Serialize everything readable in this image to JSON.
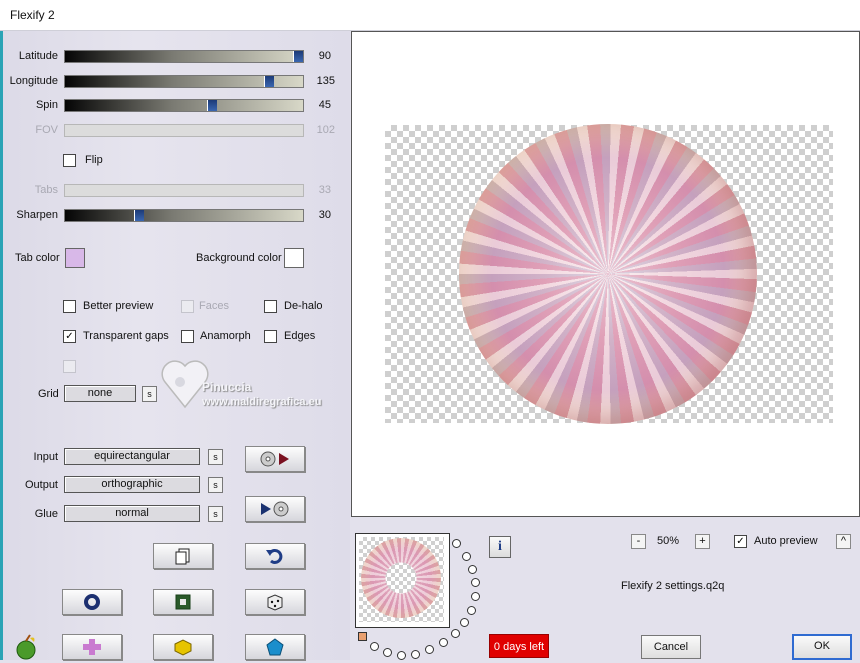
{
  "window": {
    "title": "Flexify 2"
  },
  "sliders": [
    {
      "label": "Latitude",
      "value": "90",
      "fraction": 1.0,
      "enabled": true
    },
    {
      "label": "Longitude",
      "value": "135",
      "fraction": 0.86,
      "enabled": true
    },
    {
      "label": "Spin",
      "value": "45",
      "fraction": 0.61,
      "enabled": true
    },
    {
      "label": "FOV",
      "value": "102",
      "fraction": null,
      "enabled": false
    },
    {
      "label": "Tabs",
      "value": "33",
      "fraction": null,
      "enabled": false
    },
    {
      "label": "Sharpen",
      "value": "30",
      "fraction": 0.3,
      "enabled": true
    }
  ],
  "flip": {
    "label": "Flip",
    "checked": false
  },
  "colors": {
    "tab_label": "Tab color",
    "tab_value": "#d8b8e8",
    "bg_label": "Background color",
    "bg_value": "#ffffff",
    "accent": "#2f6bd1",
    "trial_red": "#e00000"
  },
  "options": {
    "better_preview": {
      "label": "Better preview",
      "checked": false
    },
    "faces": {
      "label": "Faces",
      "checked": false,
      "enabled": false
    },
    "dehalo": {
      "label": "De-halo",
      "checked": false
    },
    "transparent_gaps": {
      "label": "Transparent gaps",
      "checked": true
    },
    "anamorph": {
      "label": "Anamorph",
      "checked": false
    },
    "edges": {
      "label": "Edges",
      "checked": false
    }
  },
  "grid": {
    "label": "Grid",
    "value": "none",
    "s_label": "s"
  },
  "projection": {
    "input_label": "Input",
    "input_value": "equirectangular",
    "output_label": "Output",
    "output_value": "orthographic",
    "glue_label": "Glue",
    "glue_value": "normal",
    "s_label": "s"
  },
  "watermark": {
    "line1": "Pinuccia",
    "line2": "www.maldiregrafica.eu"
  },
  "zoom": {
    "minus": "-",
    "value": "50%",
    "plus": "+"
  },
  "auto_preview": {
    "label": "Auto preview",
    "checked": true,
    "arrow": "^"
  },
  "settings_file": "Flexify 2 settings.q2q",
  "info_label": "i",
  "trial": "0 days left",
  "buttons": {
    "cancel": "Cancel",
    "ok": "OK"
  },
  "icons": [
    "play-forward-icon",
    "play-backward-icon",
    "copy-icon",
    "undo-icon",
    "ring-icon",
    "frame-icon",
    "dice-icon",
    "plus-icon",
    "cube-icon",
    "gem-icon",
    "apple-icon"
  ]
}
